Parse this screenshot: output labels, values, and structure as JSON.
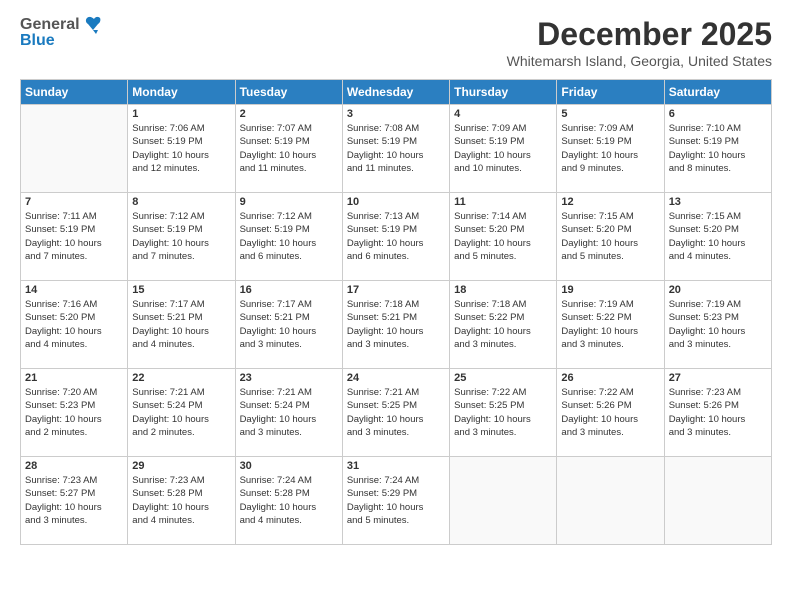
{
  "logo": {
    "general": "General",
    "blue": "Blue"
  },
  "header": {
    "month": "December 2025",
    "location": "Whitemarsh Island, Georgia, United States"
  },
  "weekdays": [
    "Sunday",
    "Monday",
    "Tuesday",
    "Wednesday",
    "Thursday",
    "Friday",
    "Saturday"
  ],
  "weeks": [
    [
      {
        "day": "",
        "info": ""
      },
      {
        "day": "1",
        "info": "Sunrise: 7:06 AM\nSunset: 5:19 PM\nDaylight: 10 hours\nand 12 minutes."
      },
      {
        "day": "2",
        "info": "Sunrise: 7:07 AM\nSunset: 5:19 PM\nDaylight: 10 hours\nand 11 minutes."
      },
      {
        "day": "3",
        "info": "Sunrise: 7:08 AM\nSunset: 5:19 PM\nDaylight: 10 hours\nand 11 minutes."
      },
      {
        "day": "4",
        "info": "Sunrise: 7:09 AM\nSunset: 5:19 PM\nDaylight: 10 hours\nand 10 minutes."
      },
      {
        "day": "5",
        "info": "Sunrise: 7:09 AM\nSunset: 5:19 PM\nDaylight: 10 hours\nand 9 minutes."
      },
      {
        "day": "6",
        "info": "Sunrise: 7:10 AM\nSunset: 5:19 PM\nDaylight: 10 hours\nand 8 minutes."
      }
    ],
    [
      {
        "day": "7",
        "info": "Sunrise: 7:11 AM\nSunset: 5:19 PM\nDaylight: 10 hours\nand 7 minutes."
      },
      {
        "day": "8",
        "info": "Sunrise: 7:12 AM\nSunset: 5:19 PM\nDaylight: 10 hours\nand 7 minutes."
      },
      {
        "day": "9",
        "info": "Sunrise: 7:12 AM\nSunset: 5:19 PM\nDaylight: 10 hours\nand 6 minutes."
      },
      {
        "day": "10",
        "info": "Sunrise: 7:13 AM\nSunset: 5:19 PM\nDaylight: 10 hours\nand 6 minutes."
      },
      {
        "day": "11",
        "info": "Sunrise: 7:14 AM\nSunset: 5:20 PM\nDaylight: 10 hours\nand 5 minutes."
      },
      {
        "day": "12",
        "info": "Sunrise: 7:15 AM\nSunset: 5:20 PM\nDaylight: 10 hours\nand 5 minutes."
      },
      {
        "day": "13",
        "info": "Sunrise: 7:15 AM\nSunset: 5:20 PM\nDaylight: 10 hours\nand 4 minutes."
      }
    ],
    [
      {
        "day": "14",
        "info": "Sunrise: 7:16 AM\nSunset: 5:20 PM\nDaylight: 10 hours\nand 4 minutes."
      },
      {
        "day": "15",
        "info": "Sunrise: 7:17 AM\nSunset: 5:21 PM\nDaylight: 10 hours\nand 4 minutes."
      },
      {
        "day": "16",
        "info": "Sunrise: 7:17 AM\nSunset: 5:21 PM\nDaylight: 10 hours\nand 3 minutes."
      },
      {
        "day": "17",
        "info": "Sunrise: 7:18 AM\nSunset: 5:21 PM\nDaylight: 10 hours\nand 3 minutes."
      },
      {
        "day": "18",
        "info": "Sunrise: 7:18 AM\nSunset: 5:22 PM\nDaylight: 10 hours\nand 3 minutes."
      },
      {
        "day": "19",
        "info": "Sunrise: 7:19 AM\nSunset: 5:22 PM\nDaylight: 10 hours\nand 3 minutes."
      },
      {
        "day": "20",
        "info": "Sunrise: 7:19 AM\nSunset: 5:23 PM\nDaylight: 10 hours\nand 3 minutes."
      }
    ],
    [
      {
        "day": "21",
        "info": "Sunrise: 7:20 AM\nSunset: 5:23 PM\nDaylight: 10 hours\nand 2 minutes."
      },
      {
        "day": "22",
        "info": "Sunrise: 7:21 AM\nSunset: 5:24 PM\nDaylight: 10 hours\nand 2 minutes."
      },
      {
        "day": "23",
        "info": "Sunrise: 7:21 AM\nSunset: 5:24 PM\nDaylight: 10 hours\nand 3 minutes."
      },
      {
        "day": "24",
        "info": "Sunrise: 7:21 AM\nSunset: 5:25 PM\nDaylight: 10 hours\nand 3 minutes."
      },
      {
        "day": "25",
        "info": "Sunrise: 7:22 AM\nSunset: 5:25 PM\nDaylight: 10 hours\nand 3 minutes."
      },
      {
        "day": "26",
        "info": "Sunrise: 7:22 AM\nSunset: 5:26 PM\nDaylight: 10 hours\nand 3 minutes."
      },
      {
        "day": "27",
        "info": "Sunrise: 7:23 AM\nSunset: 5:26 PM\nDaylight: 10 hours\nand 3 minutes."
      }
    ],
    [
      {
        "day": "28",
        "info": "Sunrise: 7:23 AM\nSunset: 5:27 PM\nDaylight: 10 hours\nand 3 minutes."
      },
      {
        "day": "29",
        "info": "Sunrise: 7:23 AM\nSunset: 5:28 PM\nDaylight: 10 hours\nand 4 minutes."
      },
      {
        "day": "30",
        "info": "Sunrise: 7:24 AM\nSunset: 5:28 PM\nDaylight: 10 hours\nand 4 minutes."
      },
      {
        "day": "31",
        "info": "Sunrise: 7:24 AM\nSunset: 5:29 PM\nDaylight: 10 hours\nand 5 minutes."
      },
      {
        "day": "",
        "info": ""
      },
      {
        "day": "",
        "info": ""
      },
      {
        "day": "",
        "info": ""
      }
    ]
  ]
}
